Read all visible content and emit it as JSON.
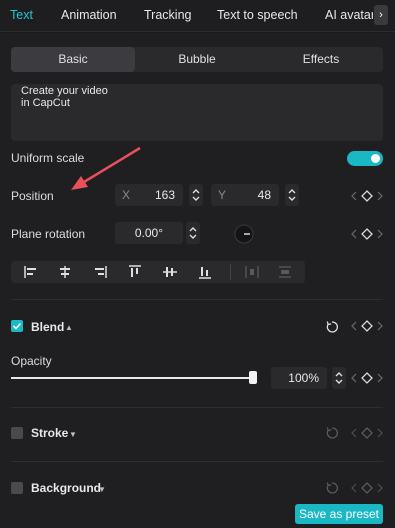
{
  "tabs": [
    {
      "label": "Text"
    },
    {
      "label": "Animation"
    },
    {
      "label": "Tracking"
    },
    {
      "label": "Text to speech"
    },
    {
      "label": "AI avatar"
    }
  ],
  "tabs_scroll": "›",
  "segments": [
    {
      "label": "Basic"
    },
    {
      "label": "Bubble"
    },
    {
      "label": "Effects"
    }
  ],
  "text_content": "Create your video\nin CapCut",
  "uniform_scale": {
    "label": "Uniform scale",
    "enabled": true
  },
  "position": {
    "label": "Position",
    "x_axis": "X",
    "x_value": "163",
    "y_axis": "Y",
    "y_value": "48"
  },
  "rotation": {
    "label": "Plane rotation",
    "value": "0.00°"
  },
  "blend": {
    "label": "Blend",
    "checked": true
  },
  "opacity": {
    "label": "Opacity",
    "value": "100%",
    "level": 1.0
  },
  "stroke": {
    "label": "Stroke",
    "checked": false
  },
  "background": {
    "label": "Background",
    "checked": false
  },
  "save_preset": "Save as preset",
  "colors": {
    "accent": "#19b8c4",
    "tab_active": "#22c7d1",
    "annotation_arrow": "#e8505b"
  }
}
